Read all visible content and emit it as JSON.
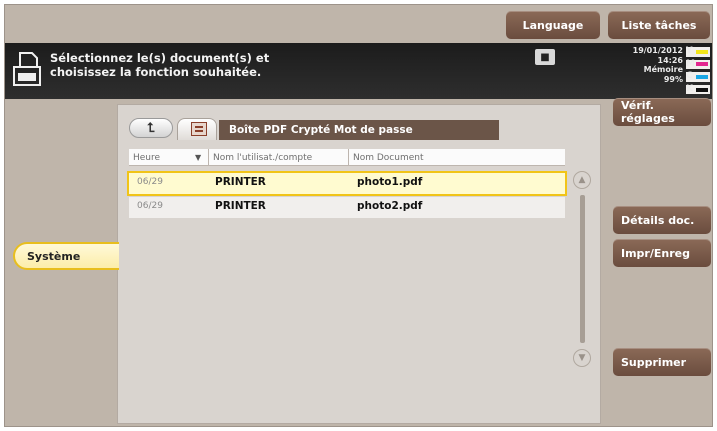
{
  "header": {
    "language_label": "Language",
    "task_list_label": "Liste tâches"
  },
  "message": {
    "text": "Sélectionnez le(s) document(s) et\nchoisissez la fonction souhaitée."
  },
  "status": {
    "date": "19/01/2012",
    "time": "14:26",
    "memory_label": "Mémoire",
    "memory_value": "99%"
  },
  "toner": [
    {
      "label": "Y",
      "color": "#f2e51a"
    },
    {
      "label": "M",
      "color": "#e2268f"
    },
    {
      "label": "C",
      "color": "#1aa7e5"
    },
    {
      "label": "K",
      "color": "#111111"
    }
  ],
  "box": {
    "title": "Boîte PDF Crypté Mot de passe",
    "up_icon": "up-arrow-icon",
    "box_icon": "box-icon"
  },
  "table": {
    "columns": [
      "Heure",
      "Nom l'utilisat./compte",
      "Nom Document"
    ],
    "rows": [
      {
        "time": "06/29",
        "user": "PRINTER",
        "document": "photo1.pdf"
      },
      {
        "time": "06/29",
        "user": "PRINTER",
        "document": "photo2.pdf"
      }
    ]
  },
  "left_tab": {
    "label": "Système"
  },
  "side_buttons": {
    "verify_label": "Vérif. réglages",
    "details_label": "Détails doc.",
    "print_save_label": "Impr/Enreg",
    "delete_label": "Supprimer"
  },
  "colors": {
    "accent_brown": "#7a5b4a",
    "selection_outline": "#f1c418"
  }
}
